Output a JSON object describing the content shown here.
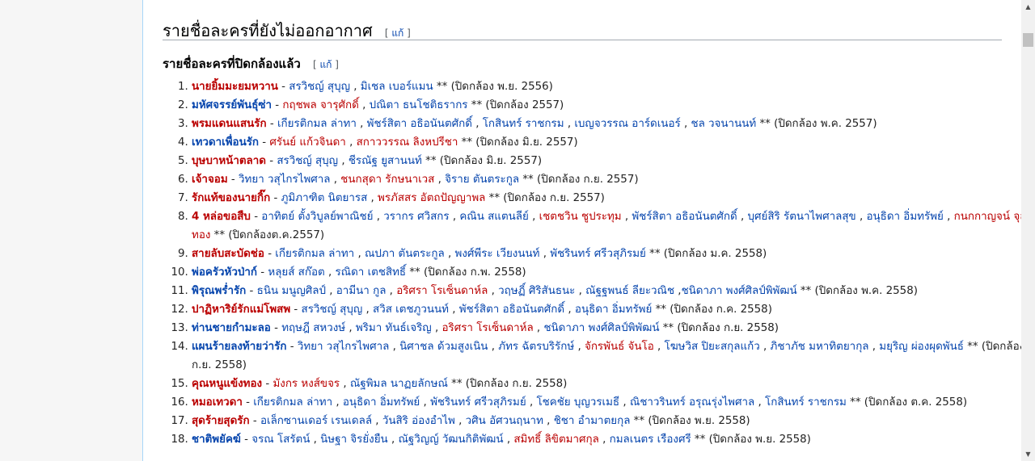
{
  "section": {
    "title": "รายชื่อละครที่ยังไม่ออกอากาศ",
    "edit": "แก้"
  },
  "subsection": {
    "title": "รายชื่อละครที่ปิดกล้องแล้ว",
    "edit": "แก้"
  },
  "items": [
    {
      "s": [
        {
          "t": "นายยิ้มมะยมหวาน",
          "c": "t"
        },
        {
          "t": " - "
        },
        {
          "t": "สรวิชญ์ สุบุญ",
          "c": "b"
        },
        {
          "t": " , "
        },
        {
          "t": "มิเชล เบอร์แมน",
          "c": "b"
        },
        {
          "t": " ** (ปิดกล้อง พ.ย. 2556)"
        }
      ]
    },
    {
      "s": [
        {
          "t": "มหัศจรรย์พันธุ์ซ่า",
          "c": "bt"
        },
        {
          "t": " - "
        },
        {
          "t": "กฤชพล จารุศักดิ์",
          "c": "r"
        },
        {
          "t": " , "
        },
        {
          "t": "ปณิตา ธนโชติธรากร",
          "c": "b"
        },
        {
          "t": " ** (ปิดกล้อง 2557)"
        }
      ]
    },
    {
      "s": [
        {
          "t": "พรมแดนแสนรัก",
          "c": "t"
        },
        {
          "t": " - "
        },
        {
          "t": "เกียรติกมล ล่าทา",
          "c": "b"
        },
        {
          "t": " , "
        },
        {
          "t": "พัชร์สิตา อธิอนันตศักดิ์",
          "c": "b"
        },
        {
          "t": " , "
        },
        {
          "t": "โกสินทร์ ราชกรม",
          "c": "b"
        },
        {
          "t": " , "
        },
        {
          "t": "เบญจวรรณ อาร์ดเนอร์",
          "c": "b"
        },
        {
          "t": " , "
        },
        {
          "t": "ชล วจนานนท์",
          "c": "b"
        },
        {
          "t": " ** (ปิดกล้อง พ.ค. 2557)"
        }
      ]
    },
    {
      "s": [
        {
          "t": "เทวดาเพื่อนรัก",
          "c": "bt"
        },
        {
          "t": " - "
        },
        {
          "t": "ศรันย์ แก้วจินดา",
          "c": "r"
        },
        {
          "t": " , "
        },
        {
          "t": "สกาววรรณ ลิงหปรีชา",
          "c": "r"
        },
        {
          "t": " ** (ปิดกล้อง มิ.ย. 2557)"
        }
      ]
    },
    {
      "s": [
        {
          "t": "บุษบาหน้าตลาด",
          "c": "t"
        },
        {
          "t": " - "
        },
        {
          "t": "สรวิชญ์ สุบุญ",
          "c": "b"
        },
        {
          "t": " , "
        },
        {
          "t": "ชีรณัฐ ยูสานนท์",
          "c": "b"
        },
        {
          "t": " ** (ปิดกล้อง มิ.ย. 2557)"
        }
      ]
    },
    {
      "s": [
        {
          "t": "เจ้าจอม",
          "c": "t"
        },
        {
          "t": " - "
        },
        {
          "t": "วิทยา วสุไกรไพศาล",
          "c": "b"
        },
        {
          "t": " , "
        },
        {
          "t": "ชนกสุดา รักษนาเวส",
          "c": "r"
        },
        {
          "t": " , "
        },
        {
          "t": "จิราย ตันตระกูล",
          "c": "b"
        },
        {
          "t": " ** (ปิดกล้อง ก.ย. 2557)"
        }
      ]
    },
    {
      "s": [
        {
          "t": "รักแท้ของนายกิ๊ก",
          "c": "t"
        },
        {
          "t": " - "
        },
        {
          "t": "ภูมิภาฑิต นิตยารส",
          "c": "b"
        },
        {
          "t": " , "
        },
        {
          "t": "พรภัสสร อัตถปัญญาพล",
          "c": "r"
        },
        {
          "t": " ** (ปิดกล้อง ก.ย. 2557)"
        }
      ]
    },
    {
      "s": [
        {
          "t": "4 หล่อขอสืบ",
          "c": "t"
        },
        {
          "t": " - "
        },
        {
          "t": "อาทิตย์ ตั้งวิบูลย์พาณิชย์",
          "c": "b"
        },
        {
          "t": " , "
        },
        {
          "t": "วรากร ศวิสกร",
          "c": "b"
        },
        {
          "t": " , "
        },
        {
          "t": "คณิน สแตนลีย์",
          "c": "b"
        },
        {
          "t": " , "
        },
        {
          "t": "เชตชวิน ชูประทุม",
          "c": "r"
        },
        {
          "t": " , "
        },
        {
          "t": "พัชร์สิตา อธิอนันตศักดิ์",
          "c": "b"
        },
        {
          "t": " , "
        },
        {
          "t": "บุศย์สิริ รัตนาไพศาลสุข",
          "c": "b"
        },
        {
          "t": " , "
        },
        {
          "t": "อนุธิดา อิ่มทรัพย์",
          "c": "b"
        },
        {
          "t": " , "
        },
        {
          "t": "กนกกาญจน์ จุลทอง",
          "c": "r"
        },
        {
          "t": " ** (ปิดกล้องต.ค.2557)"
        }
      ]
    },
    {
      "s": [
        {
          "t": "สายลับสะบัดช่อ",
          "c": "t"
        },
        {
          "t": " - "
        },
        {
          "t": "เกียรติกมล ล่าทา",
          "c": "b"
        },
        {
          "t": " , "
        },
        {
          "t": "ณปภา ตันตระกูล",
          "c": "b"
        },
        {
          "t": " , "
        },
        {
          "t": "พงศ์พีระ เวียงนนท์",
          "c": "b"
        },
        {
          "t": " , "
        },
        {
          "t": "พัชรินทร์ ศรีวสุภิรมย์",
          "c": "b"
        },
        {
          "t": " ** (ปิดกล้อง ม.ค. 2558)"
        }
      ]
    },
    {
      "s": [
        {
          "t": "พ่อครัวหัวป่าก์",
          "c": "bt"
        },
        {
          "t": " - "
        },
        {
          "t": "หลุยส์ สก๊อต",
          "c": "b"
        },
        {
          "t": " , "
        },
        {
          "t": "รณิดา เตชสิทธิ์",
          "c": "b"
        },
        {
          "t": " ** (ปิดกล้อง ก.พ. 2558)"
        }
      ]
    },
    {
      "s": [
        {
          "t": "พิรุณพร่ำรัก",
          "c": "bt"
        },
        {
          "t": " - "
        },
        {
          "t": "ธนิน มนูญศิลป์",
          "c": "b"
        },
        {
          "t": " , "
        },
        {
          "t": "อามีนา กูล",
          "c": "b"
        },
        {
          "t": " , "
        },
        {
          "t": "อริศรา โรเซ็นดาห์ล",
          "c": "r"
        },
        {
          "t": " , "
        },
        {
          "t": "วฤษฏิ์ ศิริสันธนะ",
          "c": "b"
        },
        {
          "t": " , "
        },
        {
          "t": "ณัฐฐพนธ์ ลียะวณิช",
          "c": "b"
        },
        {
          "t": " ,"
        },
        {
          "t": "ชนิดาภา พงศ์ศิลป์พิพัฒน์",
          "c": "b"
        },
        {
          "t": " ** (ปิดกล้อง พ.ค. 2558)"
        }
      ]
    },
    {
      "s": [
        {
          "t": "ปาฏิหาริย์รักแม่โพสพ",
          "c": "t"
        },
        {
          "t": " - "
        },
        {
          "t": "สรวิชญ์ สุบุญ",
          "c": "b"
        },
        {
          "t": " , "
        },
        {
          "t": "สวิส เตชภูวนนท์",
          "c": "b"
        },
        {
          "t": " , "
        },
        {
          "t": "พัชร์สิตา อธิอนันตศักดิ์",
          "c": "b"
        },
        {
          "t": " , "
        },
        {
          "t": "อนุธิดา อิ่มทรัพย์",
          "c": "b"
        },
        {
          "t": " ** (ปิดกล้อง ก.ค. 2558)"
        }
      ]
    },
    {
      "s": [
        {
          "t": "ท่านชายกำมะลอ",
          "c": "bt"
        },
        {
          "t": " - "
        },
        {
          "t": "ทฤษฎี สหวงษ์",
          "c": "b"
        },
        {
          "t": " , "
        },
        {
          "t": "พริมา ทันธ์เจริญ",
          "c": "b"
        },
        {
          "t": " , "
        },
        {
          "t": "อริศรา โรเซ็นดาห์ล",
          "c": "r"
        },
        {
          "t": " , "
        },
        {
          "t": "ชนิดาภา พงศ์ศิลป์พิพัฒน์",
          "c": "b"
        },
        {
          "t": " ** (ปิดกล้อง ก.ย. 2558)"
        }
      ]
    },
    {
      "s": [
        {
          "t": "แผนร้ายลงท้ายว่ารัก",
          "c": "bt"
        },
        {
          "t": " - "
        },
        {
          "t": "วิทยา วสุไกรไพศาล",
          "c": "b"
        },
        {
          "t": " , "
        },
        {
          "t": "นิศาชล ด้วมสูงเนิน",
          "c": "b"
        },
        {
          "t": " , "
        },
        {
          "t": "ภัทร ฉัตรบริรักษ์",
          "c": "b"
        },
        {
          "t": " , "
        },
        {
          "t": "จักรพันธ์ จันโอ",
          "c": "r"
        },
        {
          "t": " , "
        },
        {
          "t": "โฆษวิส ปิยะสกุลแก้ว",
          "c": "b"
        },
        {
          "t": " , "
        },
        {
          "t": "ภิชาภัช มหาทิตยากุล",
          "c": "b"
        },
        {
          "t": " , "
        },
        {
          "t": "มยุริญ ผ่องผุดพันธ์",
          "c": "b"
        },
        {
          "t": " ** (ปิดกล้อง ก.ย. 2558)"
        }
      ]
    },
    {
      "s": [
        {
          "t": "คุณหนูแข้งทอง",
          "c": "t"
        },
        {
          "t": " - "
        },
        {
          "t": "มังกร หงส์ขจร",
          "c": "r"
        },
        {
          "t": " , "
        },
        {
          "t": "ณัฐพิมล นาฏยลักษณ์",
          "c": "b"
        },
        {
          "t": " ** (ปิดกล้อง ก.ย. 2558)"
        }
      ]
    },
    {
      "s": [
        {
          "t": "หมอเทวดา",
          "c": "t"
        },
        {
          "t": " - "
        },
        {
          "t": "เกียรติกมล ล่าทา",
          "c": "b"
        },
        {
          "t": " , "
        },
        {
          "t": "อนุธิดา อิ่มทรัพย์",
          "c": "b"
        },
        {
          "t": " , "
        },
        {
          "t": "พัชรินทร์ ศรีวสุภิรมย์",
          "c": "b"
        },
        {
          "t": " , "
        },
        {
          "t": "โชคชัย บุญวรเมธี",
          "c": "b"
        },
        {
          "t": " , "
        },
        {
          "t": "ณิชาวรินทร์ อรุณรุ่งไพศาล",
          "c": "b"
        },
        {
          "t": " , "
        },
        {
          "t": "โกสินทร์ ราชกรม",
          "c": "b"
        },
        {
          "t": " ** (ปิดกล้อง ต.ค. 2558)"
        }
      ]
    },
    {
      "s": [
        {
          "t": "สุดร้ายสุดรัก",
          "c": "t"
        },
        {
          "t": " - "
        },
        {
          "t": "อเล็กซานเดอร์ เรนเดลล์",
          "c": "b"
        },
        {
          "t": " , "
        },
        {
          "t": "วันสิริ อ่องอำไพ",
          "c": "b"
        },
        {
          "t": " , "
        },
        {
          "t": "วศิน อัศวนฤนาท",
          "c": "b"
        },
        {
          "t": " , "
        },
        {
          "t": "ชิชา อำมาตยกุล",
          "c": "b"
        },
        {
          "t": " ** (ปิดกล้อง พ.ย. 2558)"
        }
      ]
    },
    {
      "s": [
        {
          "t": "ชาติพยัคฆ์",
          "c": "bt"
        },
        {
          "t": " - "
        },
        {
          "t": "จรณ โสรัตน์",
          "c": "b"
        },
        {
          "t": " , "
        },
        {
          "t": "นิษฐา จิรยั่งยืน",
          "c": "b"
        },
        {
          "t": " , "
        },
        {
          "t": "ณัฐวิญญ์ วัฒนกิติพัฒน์",
          "c": "b"
        },
        {
          "t": " , "
        },
        {
          "t": "สมิทธิ์ ลิขิตมาศกุล",
          "c": "r"
        },
        {
          "t": " , "
        },
        {
          "t": "กมลเนตร เรืองศรี",
          "c": "b"
        },
        {
          "t": " ** (ปิดกล้อง พ.ย. 2558)"
        }
      ]
    }
  ],
  "colors": {
    "link": "#0645ad",
    "redlink": "#ba0000",
    "border": "#a7d7f9"
  }
}
